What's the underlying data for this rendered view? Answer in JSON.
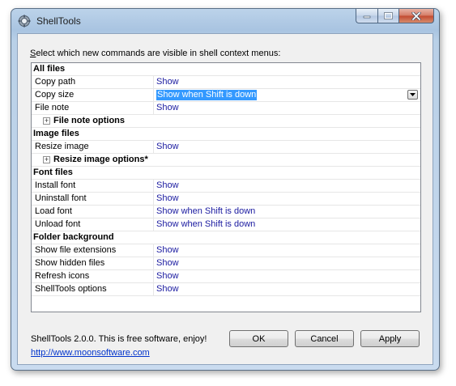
{
  "window": {
    "title": "ShellTools",
    "icon": "shelltools-gear-icon"
  },
  "caption_buttons": [
    "minimize-icon",
    "maximize-icon",
    "close-icon"
  ],
  "instruction": {
    "underlined_char": "S",
    "rest": "elect which new commands are visible in shell context menus:"
  },
  "grid": {
    "sections": [
      {
        "category": "All files",
        "rows": [
          {
            "name": "Copy path",
            "value": "Show"
          },
          {
            "name": "Copy size",
            "value": "Show when Shift is down",
            "selected": true
          },
          {
            "name": "File note",
            "value": "Show"
          }
        ],
        "group": {
          "label": "File note options",
          "expander": "+"
        }
      },
      {
        "category": "Image files",
        "rows": [
          {
            "name": "Resize image",
            "value": "Show"
          }
        ],
        "group": {
          "label": "Resize image options*",
          "expander": "+"
        }
      },
      {
        "category": "Font files",
        "rows": [
          {
            "name": "Install font",
            "value": "Show"
          },
          {
            "name": "Uninstall font",
            "value": "Show"
          },
          {
            "name": "Load font",
            "value": "Show when Shift is down"
          },
          {
            "name": "Unload font",
            "value": "Show when Shift is down"
          }
        ]
      },
      {
        "category": "Folder background",
        "rows": [
          {
            "name": "Show file extensions",
            "value": "Show"
          },
          {
            "name": "Show hidden files",
            "value": "Show"
          },
          {
            "name": "Refresh icons",
            "value": "Show"
          },
          {
            "name": "ShellTools options",
            "value": "Show"
          }
        ]
      }
    ]
  },
  "footer": {
    "info": "ShellTools 2.0.0. This is free software, enjoy!",
    "link": "http://www.moonsoftware.com"
  },
  "buttons": {
    "ok": "OK",
    "cancel": "Cancel",
    "apply": "Apply"
  },
  "colors": {
    "value_text": "#1a1aa0",
    "selection": "#3399ff",
    "link": "#0033cc"
  }
}
